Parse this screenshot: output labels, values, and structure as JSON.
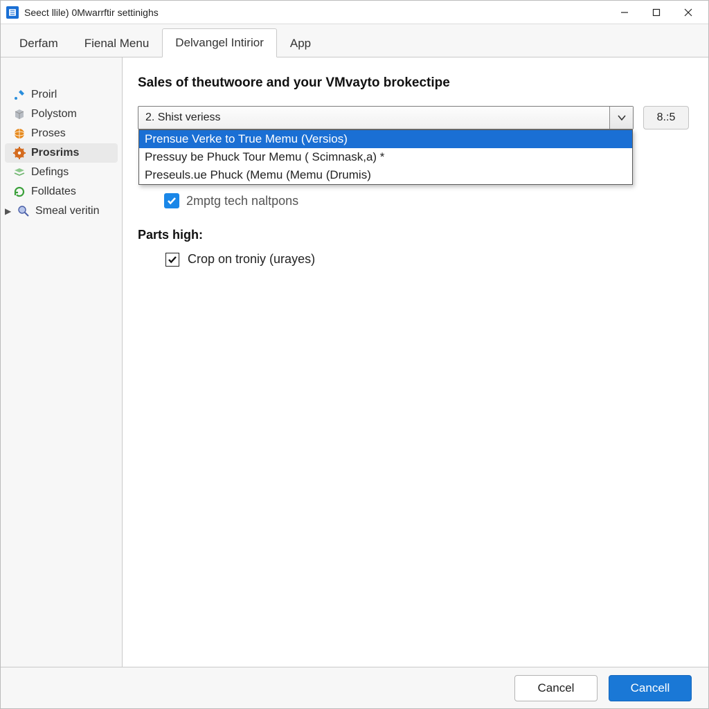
{
  "window": {
    "title": "Seect llile) 0Mwarrftir settinighs"
  },
  "tabs": [
    {
      "label": "Derfam"
    },
    {
      "label": "Fienal Menu"
    },
    {
      "label": "Delvangel Intirior"
    },
    {
      "label": "App"
    }
  ],
  "active_tab_index": 2,
  "sidebar": {
    "items": [
      {
        "label": "Proirl",
        "icon": "tools-icon",
        "color": "#2a8edc"
      },
      {
        "label": "Polystom",
        "icon": "cube-icon",
        "color": "#9aa0a6"
      },
      {
        "label": "Proses",
        "icon": "globe-icon",
        "color": "#e68a1f"
      },
      {
        "label": "Prosrims",
        "icon": "gear-icon",
        "color": "#d46b1e",
        "selected": true
      },
      {
        "label": "Defings",
        "icon": "layers-icon",
        "color": "#6cb36c"
      },
      {
        "label": "Folldates",
        "icon": "refresh-icon",
        "color": "#3aa03a"
      },
      {
        "label": "Smeal veritin",
        "icon": "search-icon",
        "color": "#4a5fa8",
        "expandable": true
      }
    ]
  },
  "main": {
    "heading": "Sales of theutwoore and your VMvayto brokectipe",
    "combo_value": "2. Shist veriess",
    "side_value": "8.:5",
    "dropdown_options": [
      "Prensue Verke to True Memu (Versios)",
      "Pressuy be Phuck Tour Memu ( Scimnask,a) *",
      "Preseuls.ue Phuck (Memu (Memu (Drumis)"
    ],
    "dropdown_highlight_index": 0,
    "under_combo_check_label": "2mptg tech naltpons",
    "section_label": "Parts high:",
    "crop_check_label": "Crop on troniy (urayes)"
  },
  "footer": {
    "cancel": "Cancel",
    "ok": "Cancell"
  }
}
